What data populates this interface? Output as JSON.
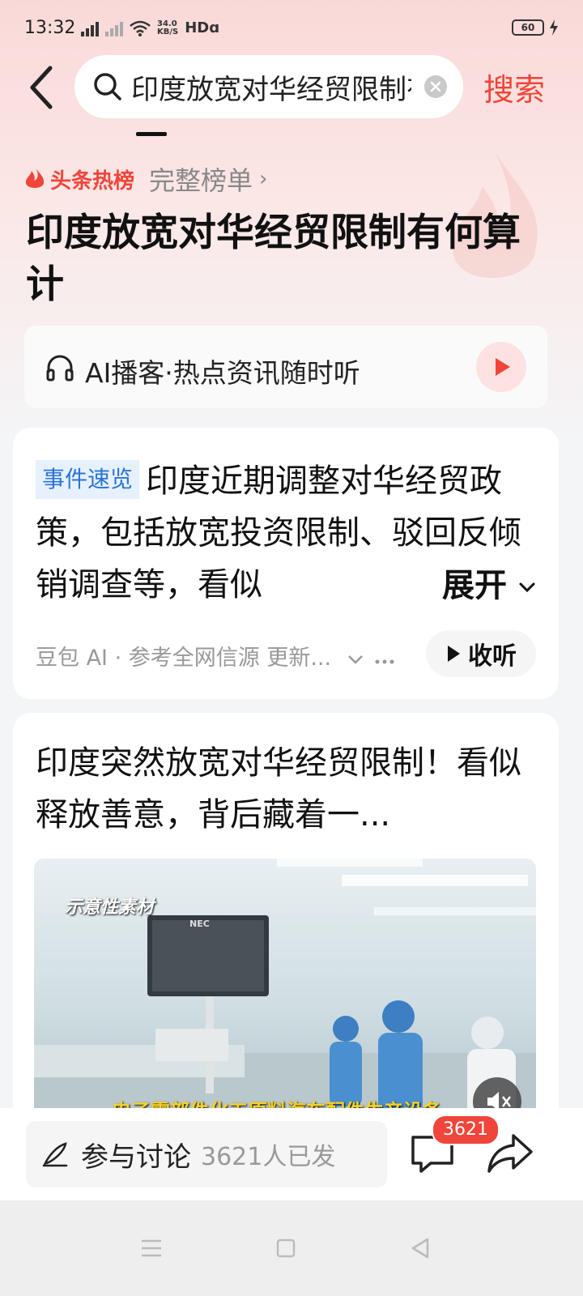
{
  "status": {
    "time": "13:32",
    "net_top": "34.0",
    "net_bottom": "KB/S",
    "hd": "HDɑ",
    "battery": "60"
  },
  "search": {
    "query": "印度放宽对华经贸限制有何算计",
    "submit_label": "搜索"
  },
  "hot_list": {
    "label": "头条热榜",
    "full_list_label": "完整榜单",
    "chevron": "›"
  },
  "headline": "印度放宽对华经贸限制有何算计",
  "podcast": {
    "text": "AI播客·热点资讯随时听"
  },
  "summary_card": {
    "tag": "事件速览",
    "text": "印度近期调整对华经贸政策，包括放宽投资限制、驳回反倾销调查等，看似",
    "expand_label": "展开",
    "meta": "豆包 AI · 参考全网信源 更新...",
    "listen_label": "收听"
  },
  "article_card": {
    "title": "印度突然放宽对华经贸限制！看似释放善意，背后藏着一...",
    "video_caption": "示意性素材",
    "video_subtitle": "电子零部件化工原料汽车配件生产设备",
    "monitor_brand": "NEC"
  },
  "bottom_bar": {
    "discuss_label": "参与讨论",
    "discuss_count": "3621人已发",
    "comment_badge": "3621"
  },
  "colors": {
    "accent": "#f0453a",
    "tag_blue": "#2a74d8"
  }
}
